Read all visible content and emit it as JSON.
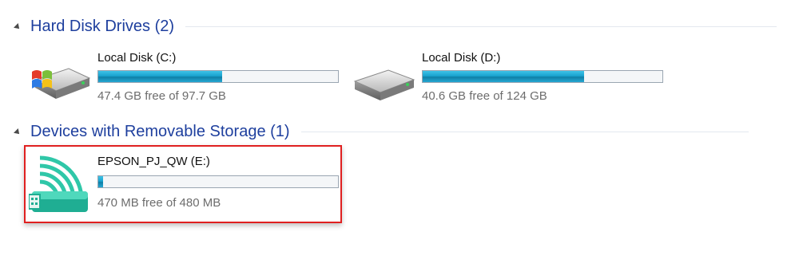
{
  "groups": {
    "hard_disks": {
      "title": "Hard Disk Drives (2)"
    },
    "removable": {
      "title": "Devices with Removable Storage (1)"
    }
  },
  "drives": {
    "c": {
      "name": "Local Disk (C:)",
      "free_text": "47.4 GB free of 97.7 GB",
      "used_fraction": 0.515,
      "icon": "windows-hard-drive-icon"
    },
    "d": {
      "name": "Local Disk (D:)",
      "free_text": "40.6 GB free of 124 GB",
      "used_fraction": 0.673,
      "icon": "hard-drive-icon"
    },
    "e": {
      "name": "EPSON_PJ_QW (E:)",
      "free_text": "470 MB free of 480 MB",
      "used_fraction": 0.021,
      "icon": "wireless-usb-drive-icon"
    }
  },
  "colors": {
    "group_title": "#1e3f9e",
    "bar_fill": "#1aa3cf",
    "highlight_border": "#e02020"
  }
}
